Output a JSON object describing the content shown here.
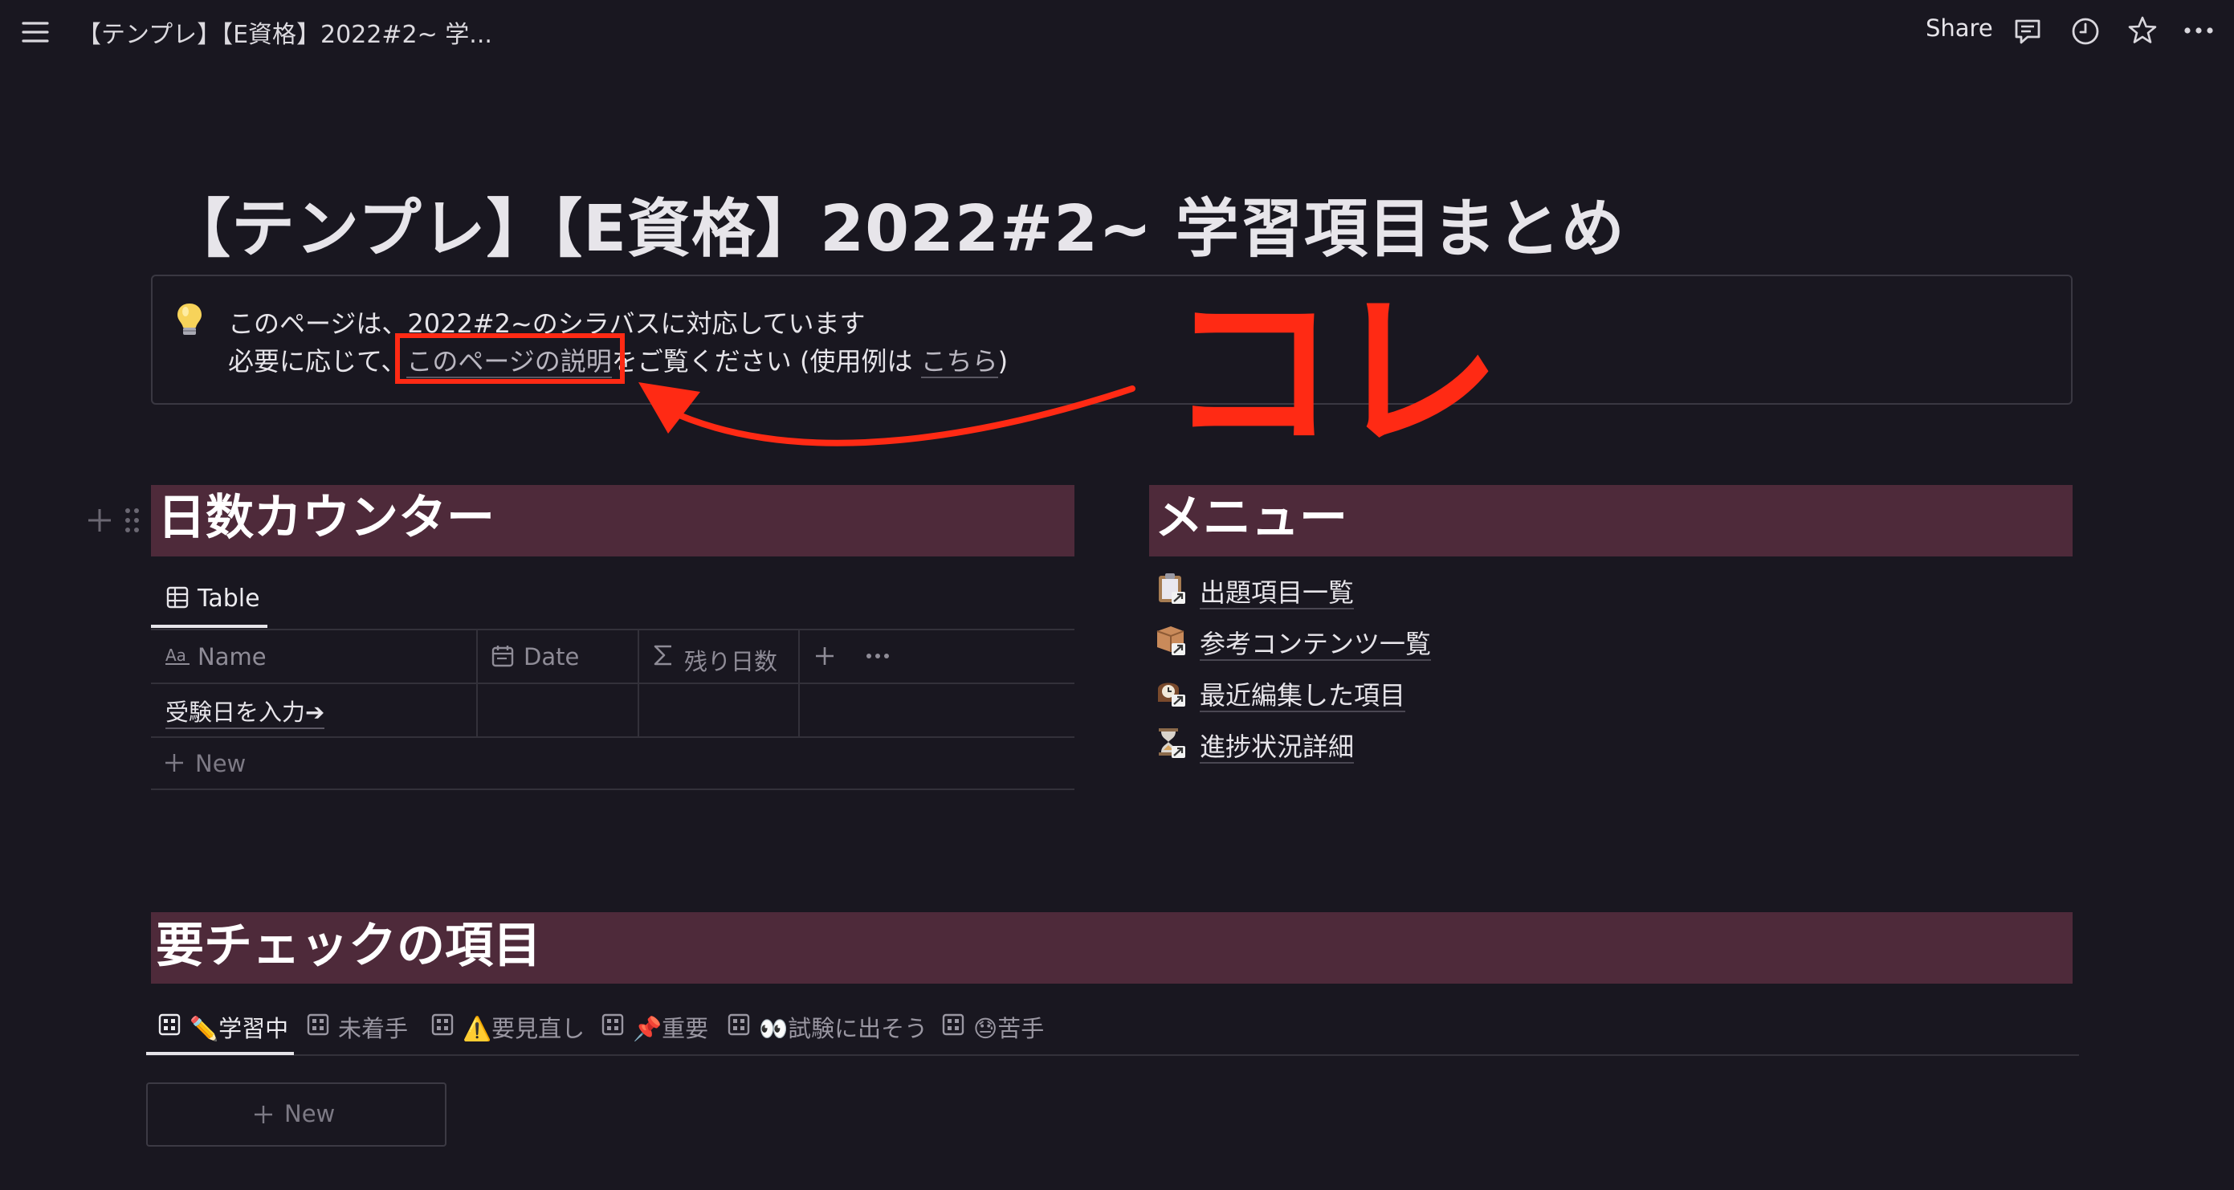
{
  "topbar": {
    "breadcrumb": "【テンプレ】【E資格】2022#2~ 学...",
    "share_label": "Share",
    "icons": [
      "menu-icon",
      "comment-icon",
      "clock-icon",
      "star-icon",
      "more-icon"
    ]
  },
  "page": {
    "title": "【テンプレ】【E資格】2022#2~ 学習項目まとめ"
  },
  "callout": {
    "icon": "lightbulb-icon",
    "line1": "このページは、2022#2~のシラバスに対応しています",
    "line2_prefix": "必要に応じて、",
    "line2_link": "このページの説明",
    "line2_middle": "をご覧ください (使用例は ",
    "line2_link2": "こちら",
    "line2_suffix": ")"
  },
  "annotation": {
    "text": "コレ",
    "color": "#ff2a14"
  },
  "counter": {
    "heading": "日数カウンター",
    "view_tab": "Table",
    "columns": [
      {
        "icon": "text-property-icon",
        "label": "Name"
      },
      {
        "icon": "calendar-icon",
        "label": "Date"
      },
      {
        "icon": "sigma-icon",
        "label": "残り日数"
      }
    ],
    "rows": [
      {
        "name": "受験日を入力➔",
        "date": "",
        "remaining": ""
      }
    ],
    "new_row_label": "New"
  },
  "menu_section": {
    "heading": "メニュー",
    "items": [
      {
        "icon": "clipboard-icon",
        "label": "出題項目一覧"
      },
      {
        "icon": "package-icon",
        "label": "参考コンテンツ一覧"
      },
      {
        "icon": "mantel-clock-icon",
        "label": "最近編集した項目"
      },
      {
        "icon": "hourglass-icon",
        "label": "進捗状況詳細"
      }
    ]
  },
  "check_section": {
    "heading": "要チェックの項目",
    "tabs": [
      {
        "emoji": "✏️",
        "label": "学習中",
        "active": true
      },
      {
        "emoji": "",
        "label": "未着手",
        "active": false
      },
      {
        "emoji": "⚠️",
        "label": "要見直し",
        "active": false
      },
      {
        "emoji": "📌",
        "label": "重要",
        "active": false
      },
      {
        "emoji": "👀",
        "label": "試験に出そう",
        "active": false
      },
      {
        "emoji": "😓",
        "label": "苦手",
        "active": false
      }
    ],
    "new_label": "New"
  },
  "colors": {
    "background": "#191720",
    "heading_band": "#4e2a3a",
    "annotation_red": "#ff2a14"
  }
}
